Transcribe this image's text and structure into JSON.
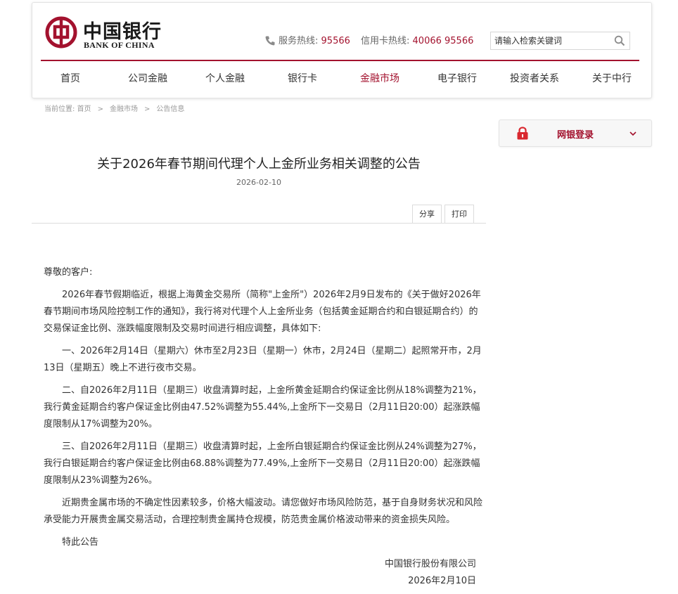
{
  "header": {
    "logo_cn": "中国银行",
    "logo_en": "BANK OF CHINA",
    "hotline_label": "服务热线:",
    "hotline_number": "95566",
    "card_hotline_label": "信用卡热线:",
    "card_hotline_number": "40066 95566",
    "search_placeholder": "请输入检索关键词",
    "brand_color": "#a3122e"
  },
  "nav": {
    "items": [
      "首页",
      "公司金融",
      "个人金融",
      "银行卡",
      "金融市场",
      "电子银行",
      "投资者关系",
      "关于中行"
    ],
    "active": "金融市场"
  },
  "breadcrumb": {
    "prefix": "当前位置:",
    "items": [
      "首页",
      "金融市场",
      "公告信息"
    ]
  },
  "login": {
    "label": "网银登录"
  },
  "article": {
    "title": "关于2026年春节期间代理个人上金所业务相关调整的公告",
    "date": "2026-02-10",
    "share_label": "分享",
    "print_label": "打印",
    "greeting": "尊敬的客户:",
    "lines": [
      "　　2026年春节假期临近，根据上海黄金交易所（简称\"上金所\"）2026年2月9日发布的《关于做好2026年",
      "春节期间市场风险控制工作的通知》，我行将对代理个人上金所业务（包括黄金延期合约和白银延期合约）的",
      "交易保证金比例、涨跌幅度限制及交易时间进行相应调整，具体如下:",
      "　　一、2026年2月14日（星期六）休市至2月23日（星期一）休市，2月24日（星期二）起照常开市，2月",
      "13日（星期五）晚上不进行夜市交易。",
      "　　二、自2026年2月11日（星期三）收盘清算时起，上金所黄金延期合约保证金比例从18%调整为21%，",
      "我行黄金延期合约客户保证金比例由47.52%调整为55.44%,上金所下一交易日（2月11日20:00）起涨跌幅",
      "度限制从17%调整为20%。",
      "　　三、自2026年2月11日（星期三）收盘清算时起，上金所白银延期合约保证金比例从24%调整为27%，",
      "我行白银延期合约客户保证金比例由68.88%调整为77.49%,上金所下一交易日（2月11日20:00）起涨跌幅",
      "度限制从23%调整为26%。",
      "　　近期贵金属市场的不确定性因素较多，价格大幅波动。请您做好市场风险防范，基于自身财务状况和风险",
      "承受能力开展贵金属交易活动，合理控制贵金属持仓规模，防范贵金属价格波动带来的资金损失风险。",
      "　　特此公告"
    ],
    "signature": "中国银行股份有限公司",
    "sign_date": "2026年2月10日"
  }
}
